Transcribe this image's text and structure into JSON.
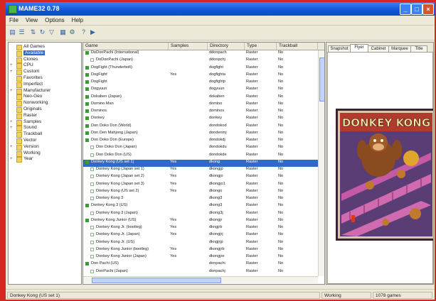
{
  "window": {
    "title": "MAME32 0.78"
  },
  "menu": [
    "File",
    "View",
    "Options",
    "Help"
  ],
  "toolbar_icons": [
    "list-view-icon",
    "details-view-icon",
    "sort-icon",
    "refresh-icon",
    "filter-icon",
    "grid-icon",
    "properties-icon",
    "help-icon",
    "play-icon"
  ],
  "folders": [
    {
      "label": "All Games",
      "expander": ""
    },
    {
      "label": "Available",
      "expander": "",
      "selected": true
    },
    {
      "label": "Clones",
      "expander": ""
    },
    {
      "label": "CPU",
      "expander": "+"
    },
    {
      "label": "Custom",
      "expander": "+"
    },
    {
      "label": "Favorites",
      "expander": ""
    },
    {
      "label": "Imperfect",
      "expander": ""
    },
    {
      "label": "Manufacturer",
      "expander": "+"
    },
    {
      "label": "Neo-Geo",
      "expander": ""
    },
    {
      "label": "Nonworking",
      "expander": ""
    },
    {
      "label": "Originals",
      "expander": ""
    },
    {
      "label": "Raster",
      "expander": ""
    },
    {
      "label": "Samples",
      "expander": "+"
    },
    {
      "label": "Sound",
      "expander": "+"
    },
    {
      "label": "Trackball",
      "expander": ""
    },
    {
      "label": "Vector",
      "expander": ""
    },
    {
      "label": "Version",
      "expander": "+"
    },
    {
      "label": "Working",
      "expander": ""
    },
    {
      "label": "Year",
      "expander": "+"
    }
  ],
  "columns": [
    "Game",
    "Samples",
    "Directory",
    "Type",
    "Trackball"
  ],
  "games": [
    {
      "title": "DoDonPachi (International)",
      "samples": "",
      "dir": "ddonpach",
      "type": "Raster",
      "trackball": "No",
      "clone": false
    },
    {
      "title": "DoDonPachi (Japan)",
      "samples": "",
      "dir": "ddonpchj",
      "type": "Raster",
      "trackball": "No",
      "clone": true
    },
    {
      "title": "DogFight (Thunderbolt)",
      "samples": "",
      "dir": "dogfight",
      "type": "Raster",
      "trackball": "No",
      "clone": false
    },
    {
      "title": "DogFight",
      "samples": "Yes",
      "dir": "dogfighta",
      "type": "Raster",
      "trackball": "No",
      "clone": false
    },
    {
      "title": "DogFight",
      "samples": "",
      "dir": "dogfightp",
      "type": "Raster",
      "trackball": "No",
      "clone": false
    },
    {
      "title": "Dogyuun",
      "samples": "",
      "dir": "dogyuun",
      "type": "Raster",
      "trackball": "No",
      "clone": false
    },
    {
      "title": "Dokaben (Japan)",
      "samples": "",
      "dir": "dokaben",
      "type": "Raster",
      "trackball": "No",
      "clone": false
    },
    {
      "title": "Domino Man",
      "samples": "",
      "dir": "domino",
      "type": "Raster",
      "trackball": "No",
      "clone": false
    },
    {
      "title": "Dominos",
      "samples": "",
      "dir": "dominos",
      "type": "Raster",
      "trackball": "No",
      "clone": false
    },
    {
      "title": "Donkey",
      "samples": "",
      "dir": "donkey",
      "type": "Raster",
      "trackball": "No",
      "clone": false
    },
    {
      "title": "Don Doko Don (World)",
      "samples": "",
      "dir": "dondokod",
      "type": "Raster",
      "trackball": "No",
      "clone": false
    },
    {
      "title": "Don Den Mahjong (Japan)",
      "samples": "",
      "dir": "dondenmj",
      "type": "Raster",
      "trackball": "No",
      "clone": false
    },
    {
      "title": "Don Doko Don (Europe)",
      "samples": "",
      "dir": "dondokdj",
      "type": "Raster",
      "trackball": "No",
      "clone": false
    },
    {
      "title": "Don Doko Don (Japan)",
      "samples": "",
      "dir": "dondokdu",
      "type": "Raster",
      "trackball": "No",
      "clone": true
    },
    {
      "title": "Don Doko Don (US)",
      "samples": "",
      "dir": "dondokde",
      "type": "Raster",
      "trackball": "No",
      "clone": true
    },
    {
      "title": "Donkey Kong (US set 1)",
      "samples": "Yes",
      "dir": "dkong",
      "type": "Raster",
      "trackball": "No",
      "clone": false,
      "selected": true
    },
    {
      "title": "Donkey Kong (Japan set 1)",
      "samples": "Yes",
      "dir": "dkongjp",
      "type": "Raster",
      "trackball": "No",
      "clone": true
    },
    {
      "title": "Donkey Kong (Japan set 2)",
      "samples": "Yes",
      "dir": "dkongjo",
      "type": "Raster",
      "trackball": "No",
      "clone": true
    },
    {
      "title": "Donkey Kong (Japan set 3)",
      "samples": "Yes",
      "dir": "dkongjo1",
      "type": "Raster",
      "trackball": "No",
      "clone": true
    },
    {
      "title": "Donkey Kong (US set 2)",
      "samples": "Yes",
      "dir": "dkongo",
      "type": "Raster",
      "trackball": "No",
      "clone": true
    },
    {
      "title": "Donkey Kong 3",
      "samples": "",
      "dir": "dkong3",
      "type": "Raster",
      "trackball": "No",
      "clone": true
    },
    {
      "title": "Donkey Kong 3 (US)",
      "samples": "",
      "dir": "dkong3",
      "type": "Raster",
      "trackball": "No",
      "clone": false
    },
    {
      "title": "Donkey Kong 3 (Japan)",
      "samples": "",
      "dir": "dkong3j",
      "type": "Raster",
      "trackball": "No",
      "clone": true
    },
    {
      "title": "Donkey Kong Junior (US)",
      "samples": "Yes",
      "dir": "dkongjr",
      "type": "Raster",
      "trackball": "No",
      "clone": false
    },
    {
      "title": "Donkey Kong Jr. (bootleg)",
      "samples": "Yes",
      "dir": "dkngjrb",
      "type": "Raster",
      "trackball": "No",
      "clone": true
    },
    {
      "title": "Donkey Kong Jr. (Japan)",
      "samples": "Yes",
      "dir": "dkongjrj",
      "type": "Raster",
      "trackball": "No",
      "clone": true
    },
    {
      "title": "Donkey Kong Jr. (US)",
      "samples": "",
      "dir": "dkngjrjp",
      "type": "Raster",
      "trackball": "No",
      "clone": true
    },
    {
      "title": "Donkey Kong Junior (bootleg)",
      "samples": "Yes",
      "dir": "dkongjrb",
      "type": "Raster",
      "trackball": "No",
      "clone": true
    },
    {
      "title": "Donkey Kong Junior (Japan)",
      "samples": "Yes",
      "dir": "dkongjre",
      "type": "Raster",
      "trackball": "No",
      "clone": true
    },
    {
      "title": "Don Pachi (US)",
      "samples": "",
      "dir": "donpachi",
      "type": "Raster",
      "trackball": "No",
      "clone": false
    },
    {
      "title": "DonPachi (Japan)",
      "samples": "",
      "dir": "donpachj",
      "type": "Raster",
      "trackball": "No",
      "clone": true
    }
  ],
  "tabs": [
    "Snapshot",
    "Flyer",
    "Cabinet",
    "Marquee",
    "Title"
  ],
  "active_tab": 1,
  "artwork": {
    "text": "DONKEY KONG"
  },
  "status": {
    "left": "Donkey Kong (US set 1)",
    "middle": "Working",
    "right": "1078 games"
  },
  "colors": {
    "titlebar": "#0f56d6",
    "selection": "#3169c6",
    "game_icon": "#3d9a36",
    "desktop": "#d3271f"
  }
}
